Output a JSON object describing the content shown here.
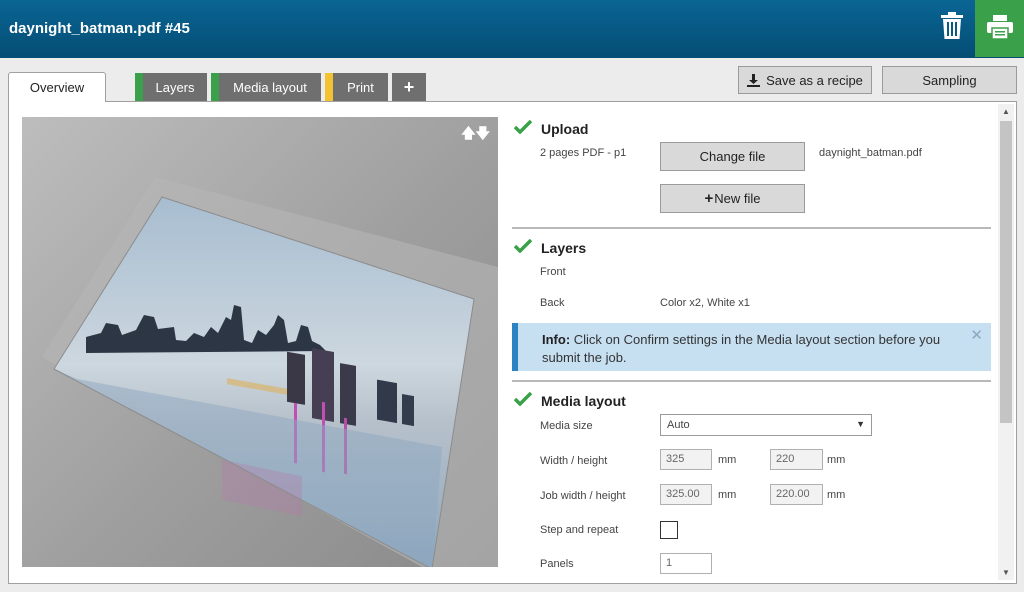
{
  "header": {
    "title": "daynight_batman.pdf #45"
  },
  "tabs": [
    {
      "label": "Overview",
      "active": true
    },
    {
      "label": "Layers",
      "color": "#3aa14a"
    },
    {
      "label": "Media layout",
      "color": "#3aa14a"
    },
    {
      "label": "Print",
      "color": "#f2c230"
    },
    {
      "label": "+"
    }
  ],
  "toolbar": {
    "save_recipe": "Save as a recipe",
    "sampling": "Sampling"
  },
  "upload": {
    "title": "Upload",
    "pages": "2 pages PDF - p1",
    "change_file": "Change file",
    "new_file": "New file",
    "filename": "daynight_batman.pdf"
  },
  "layers": {
    "title": "Layers",
    "front_label": "Front",
    "back_label": "Back",
    "back_value": "Color x2, White x1"
  },
  "info": {
    "prefix": "Info:",
    "line1": " Click on Confirm settings in the Media layout section before you",
    "line2": "submit the job."
  },
  "media": {
    "title": "Media layout",
    "size_label": "Media size",
    "size_value": "Auto",
    "wh_label": "Width / height",
    "width": "325",
    "height": "220",
    "job_wh_label": "Job width / height",
    "job_width": "325.00",
    "job_height": "220.00",
    "unit": "mm",
    "step_label": "Step and repeat",
    "panels_label": "Panels",
    "panels_value": "1"
  },
  "colors": {
    "header": "#0a6594",
    "print": "#3aa14a",
    "info_bg": "#c6dff1",
    "info_border": "#2b83c2"
  }
}
